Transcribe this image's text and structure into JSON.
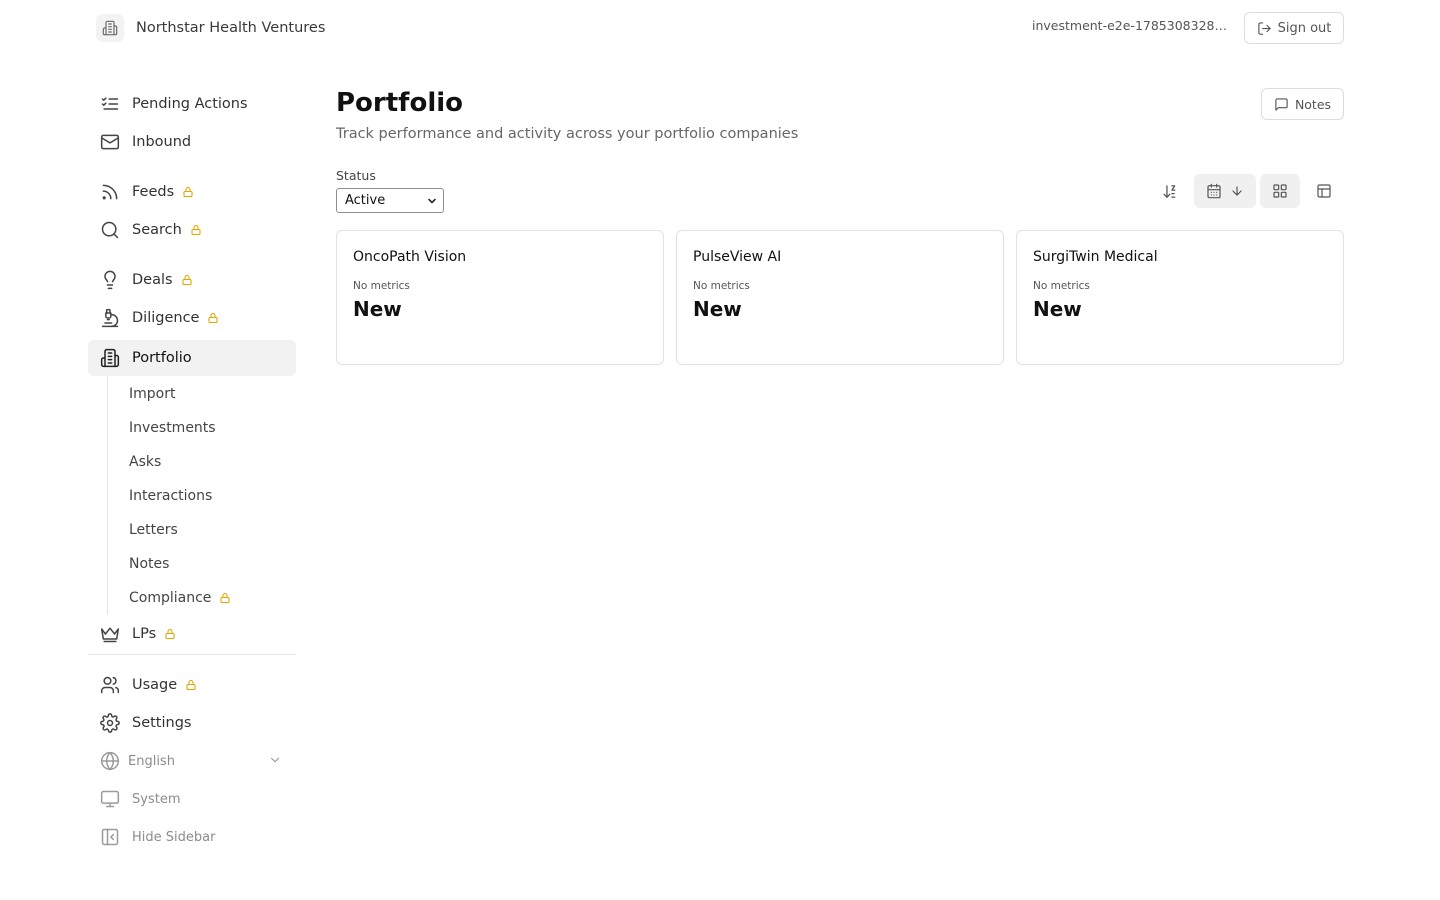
{
  "header": {
    "org_name": "Northstar Health Ventures",
    "user_id": "investment-e2e-17853083287...",
    "sign_out_label": "Sign out"
  },
  "sidebar": {
    "items": [
      {
        "label": "Pending Actions",
        "icon": "list-check-icon",
        "locked": false
      },
      {
        "label": "Inbound",
        "icon": "mail-icon",
        "locked": false
      },
      {
        "label": "Feeds",
        "icon": "rss-icon",
        "locked": true
      },
      {
        "label": "Search",
        "icon": "search-icon",
        "locked": true
      },
      {
        "label": "Deals",
        "icon": "lightbulb-icon",
        "locked": true
      },
      {
        "label": "Diligence",
        "icon": "microscope-icon",
        "locked": true
      },
      {
        "label": "Portfolio",
        "icon": "building-icon",
        "locked": false,
        "active": true
      }
    ],
    "portfolio_sub": [
      {
        "label": "Import",
        "locked": false
      },
      {
        "label": "Investments",
        "locked": false
      },
      {
        "label": "Asks",
        "locked": false
      },
      {
        "label": "Interactions",
        "locked": false
      },
      {
        "label": "Letters",
        "locked": false
      },
      {
        "label": "Notes",
        "locked": false
      },
      {
        "label": "Compliance",
        "locked": true
      }
    ],
    "lps": {
      "label": "LPs",
      "icon": "crown-icon",
      "locked": true
    },
    "bottom": [
      {
        "label": "Usage",
        "icon": "users-icon",
        "locked": true
      },
      {
        "label": "Settings",
        "icon": "gear-icon",
        "locked": false
      }
    ],
    "language": "English",
    "theme": "System",
    "hide_sidebar": "Hide Sidebar"
  },
  "main": {
    "title": "Portfolio",
    "subtitle": "Track performance and activity across your portfolio companies",
    "notes_label": "Notes",
    "status_filter": {
      "label": "Status",
      "selected": "Active"
    },
    "view_mode": "grid",
    "cards": [
      {
        "name": "OncoPath Vision",
        "metrics": "No metrics",
        "status": "New"
      },
      {
        "name": "PulseView AI",
        "metrics": "No metrics",
        "status": "New"
      },
      {
        "name": "SurgiTwin Medical",
        "metrics": "No metrics",
        "status": "New"
      }
    ]
  },
  "colors": {
    "accent_lock": "#e0a800",
    "active_bg": "#f2f2f2",
    "border": "#e2e2e2"
  }
}
